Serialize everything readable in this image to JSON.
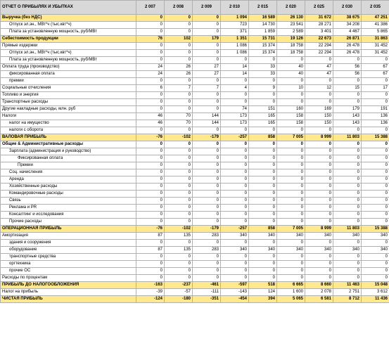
{
  "header": {
    "title": "ОТЧЕТ О ПРИБЫЛЯХ И УБЫТКАХ",
    "years": [
      "2 007",
      "2 008",
      "2 009",
      "2 010",
      "2 015",
      "2 020",
      "2 025",
      "2 030",
      "2 035"
    ]
  },
  "colors": {
    "highlight": "#ffe98c",
    "header_bg": "#d8d8d8",
    "grid": "#b0b0b0"
  },
  "rows": [
    {
      "label": "Выручка (без НДС)",
      "bold": true,
      "hl": true,
      "indent": 0,
      "values": [
        "0",
        "0",
        "0",
        "1 094",
        "16 589",
        "26 130",
        "31 672",
        "38 675",
        "47 251"
      ]
    },
    {
      "label": "Отпуск эл.эн., МВт*ч (тыс.квт*ч)",
      "indent": 1,
      "values": [
        "0",
        "0",
        "0",
        "723",
        "14 730",
        "23 541",
        "28 271",
        "34 208",
        "41 386"
      ]
    },
    {
      "label": "Плата за установленную мощность, руб/МВт",
      "indent": 1,
      "values": [
        "0",
        "0",
        "0",
        "371",
        "1 859",
        "2 589",
        "3 401",
        "4 467",
        "5 865"
      ]
    },
    {
      "label": "Себестоимость продукции",
      "bold": true,
      "hl": true,
      "indent": 0,
      "values": [
        "76",
        "102",
        "179",
        "1 351",
        "15 731",
        "19 126",
        "22 673",
        "26 871",
        "31 863"
      ]
    },
    {
      "label": "Прямые издержки",
      "indent": 0,
      "values": [
        "0",
        "0",
        "0",
        "1 086",
        "15 374",
        "18 758",
        "22 294",
        "26 478",
        "31 452"
      ]
    },
    {
      "label": "Отпуск эл.эн., МВт*ч (тыс.квт*ч)",
      "indent": 1,
      "values": [
        "0",
        "0",
        "0",
        "1 086",
        "15 374",
        "18 758",
        "22 294",
        "26 478",
        "31 452"
      ]
    },
    {
      "label": "Плата за установленную мощность, руб/МВт",
      "indent": 1,
      "values": [
        "0",
        "0",
        "0",
        "0",
        "0",
        "0",
        "0",
        "0",
        "0"
      ]
    },
    {
      "label": "Оплата труда (производство)",
      "indent": 0,
      "values": [
        "24",
        "26",
        "27",
        "14",
        "33",
        "40",
        "47",
        "56",
        "67"
      ]
    },
    {
      "label": "фиксированная оплата",
      "indent": 1,
      "values": [
        "24",
        "26",
        "27",
        "14",
        "33",
        "40",
        "47",
        "56",
        "67"
      ]
    },
    {
      "label": "премии",
      "indent": 1,
      "values": [
        "0",
        "0",
        "0",
        "0",
        "0",
        "0",
        "0",
        "0",
        "0"
      ]
    },
    {
      "label": "Социальные отчисления",
      "indent": 0,
      "values": [
        "6",
        "7",
        "7",
        "4",
        "9",
        "10",
        "12",
        "15",
        "17"
      ]
    },
    {
      "label": "Топливо и энергия",
      "indent": 0,
      "values": [
        "0",
        "0",
        "0",
        "0",
        "0",
        "0",
        "0",
        "0",
        "0"
      ]
    },
    {
      "label": "Транспортные расходы",
      "indent": 0,
      "values": [
        "0",
        "0",
        "0",
        "0",
        "0",
        "0",
        "0",
        "0",
        "0"
      ]
    },
    {
      "label": "Другие накладные расходы, млн. руб",
      "indent": 0,
      "values": [
        "0",
        "0",
        "0",
        "74",
        "151",
        "160",
        "169",
        "179",
        "191"
      ]
    },
    {
      "label": "Налоги",
      "indent": 0,
      "values": [
        "46",
        "70",
        "144",
        "173",
        "165",
        "158",
        "150",
        "143",
        "136"
      ]
    },
    {
      "label": "налог на имущество",
      "indent": 1,
      "values": [
        "46",
        "70",
        "144",
        "173",
        "165",
        "158",
        "150",
        "143",
        "136"
      ]
    },
    {
      "label": "налоги с оборота",
      "indent": 1,
      "values": [
        "0",
        "0",
        "0",
        "0",
        "0",
        "0",
        "0",
        "0",
        "0"
      ]
    },
    {
      "label": "ВАЛОВАЯ ПРИБЫЛЬ",
      "bold": true,
      "hl": true,
      "indent": 0,
      "values": [
        "-76",
        "-102",
        "-179",
        "-257",
        "858",
        "7 005",
        "8 999",
        "11 803",
        "15 388"
      ]
    },
    {
      "label": "Общие & Административные расходы",
      "bold": true,
      "indent": 0,
      "values": [
        "0",
        "0",
        "0",
        "0",
        "0",
        "0",
        "0",
        "0",
        "0"
      ]
    },
    {
      "label": "Зарплата (администрация и руководство)",
      "indent": 1,
      "values": [
        "0",
        "0",
        "0",
        "0",
        "0",
        "0",
        "0",
        "0",
        "0"
      ]
    },
    {
      "label": "Фиксированная оплата",
      "indent": 2,
      "values": [
        "0",
        "0",
        "0",
        "0",
        "0",
        "0",
        "0",
        "0",
        "0"
      ]
    },
    {
      "label": "Премии",
      "indent": 2,
      "values": [
        "0",
        "0",
        "0",
        "0",
        "0",
        "0",
        "0",
        "0",
        "0"
      ]
    },
    {
      "label": "Соц. начисления",
      "indent": 1,
      "values": [
        "0",
        "0",
        "0",
        "0",
        "0",
        "0",
        "0",
        "0",
        "0"
      ]
    },
    {
      "label": "Аренда",
      "indent": 1,
      "values": [
        "0",
        "0",
        "0",
        "0",
        "0",
        "0",
        "0",
        "0",
        "0"
      ]
    },
    {
      "label": "Хозяйственные расходы",
      "indent": 1,
      "values": [
        "0",
        "0",
        "0",
        "0",
        "0",
        "0",
        "0",
        "0",
        "0"
      ]
    },
    {
      "label": "Командировочные расходы",
      "indent": 1,
      "values": [
        "0",
        "0",
        "0",
        "0",
        "0",
        "0",
        "0",
        "0",
        "0"
      ]
    },
    {
      "label": "Связь",
      "indent": 1,
      "values": [
        "0",
        "0",
        "0",
        "0",
        "0",
        "0",
        "0",
        "0",
        "0"
      ]
    },
    {
      "label": "Реклама и PR",
      "indent": 1,
      "values": [
        "0",
        "0",
        "0",
        "0",
        "0",
        "0",
        "0",
        "0",
        "0"
      ]
    },
    {
      "label": "Консалтинг и исследования",
      "indent": 1,
      "values": [
        "0",
        "0",
        "0",
        "0",
        "0",
        "0",
        "0",
        "0",
        "0"
      ]
    },
    {
      "label": "Прочие расходы",
      "indent": 1,
      "values": [
        "0",
        "0",
        "0",
        "0",
        "0",
        "0",
        "0",
        "0",
        "0"
      ]
    },
    {
      "label": "ОПЕРАЦИОННАЯ ПРИБЫЛЬ",
      "bold": true,
      "hl": true,
      "indent": 0,
      "values": [
        "-76",
        "-102",
        "-179",
        "-257",
        "858",
        "7 005",
        "8 999",
        "11 803",
        "15 388"
      ]
    },
    {
      "label": "Амортизация",
      "indent": 0,
      "values": [
        "87",
        "135",
        "283",
        "340",
        "340",
        "340",
        "340",
        "340",
        "340"
      ]
    },
    {
      "label": "здания и сооружения",
      "indent": 1,
      "values": [
        "0",
        "0",
        "0",
        "0",
        "0",
        "0",
        "0",
        "0",
        "0"
      ]
    },
    {
      "label": "оборудование",
      "indent": 1,
      "values": [
        "87",
        "135",
        "283",
        "340",
        "340",
        "340",
        "340",
        "340",
        "340"
      ]
    },
    {
      "label": "транспортные средства",
      "indent": 1,
      "values": [
        "0",
        "0",
        "0",
        "0",
        "0",
        "0",
        "0",
        "0",
        "0"
      ]
    },
    {
      "label": "оргтехника",
      "indent": 1,
      "values": [
        "0",
        "0",
        "0",
        "0",
        "0",
        "0",
        "0",
        "0",
        "0"
      ]
    },
    {
      "label": "прочие ОС",
      "indent": 1,
      "values": [
        "0",
        "0",
        "0",
        "0",
        "0",
        "0",
        "0",
        "0",
        "0"
      ]
    },
    {
      "label": "Расходы по процентам",
      "indent": 0,
      "values": [
        "0",
        "0",
        "0",
        "0",
        "0",
        "0",
        "0",
        "0",
        "0"
      ]
    },
    {
      "label": "ПРИБЫЛЬ ДО НАЛОГООБЛОЖЕНИЯ",
      "bold": true,
      "hl": true,
      "indent": 0,
      "values": [
        "-163",
        "-237",
        "-461",
        "-597",
        "518",
        "6 665",
        "8 660",
        "11 463",
        "15 048"
      ]
    },
    {
      "label": "Налог на прибыль",
      "indent": 0,
      "values": [
        "-39",
        "-57",
        "-111",
        "-143",
        "124",
        "1 600",
        "2 078",
        "2 751",
        "3 612"
      ]
    },
    {
      "label": "ЧИСТАЯ ПРИБЫЛЬ",
      "bold": true,
      "hl": true,
      "indent": 0,
      "values": [
        "-124",
        "-180",
        "-351",
        "-454",
        "394",
        "5 065",
        "6 581",
        "8 712",
        "11 436"
      ]
    }
  ]
}
